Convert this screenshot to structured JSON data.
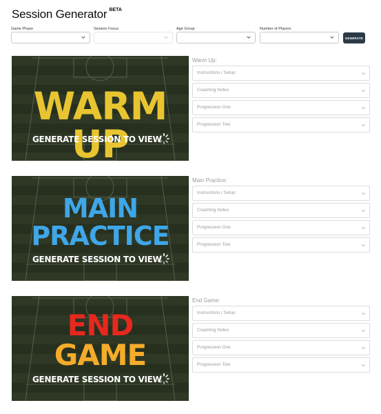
{
  "header": {
    "title": "Session Generator",
    "badge": "BETA"
  },
  "filters": [
    {
      "label": "Game Phase",
      "value": ""
    },
    {
      "label": "Session Focus",
      "value": ""
    },
    {
      "label": "Age Group",
      "value": ""
    },
    {
      "label": "Number of Players",
      "value": ""
    }
  ],
  "generate_button": "GENERATE",
  "sections": [
    {
      "title": "Warm Up:",
      "banner_lines": [
        "WARM UP"
      ],
      "banner_color": "#e8c530",
      "banner_caption": "GENERATE SESSION TO VIEW",
      "items": [
        "Instructions / Setup",
        "Coaching Notes",
        "Progression One",
        "Progression Two"
      ]
    },
    {
      "title": "Main Practice:",
      "banner_lines": [
        "MAIN",
        "PRACTICE"
      ],
      "banner_color": "#3fa6e8",
      "banner_caption": "GENERATE SESSION TO VIEW",
      "items": [
        "Instructions / Setup",
        "Coaching Notes",
        "Progression One",
        "Progression Two"
      ]
    },
    {
      "title": "End Game:",
      "banner_lines": [
        "END",
        "GAME"
      ],
      "banner_colors": [
        "#e8271d",
        "#f4ac2a"
      ],
      "banner_caption": "GENERATE SESSION TO VIEW",
      "items": [
        "Instructions / Setup",
        "Coaching Notes",
        "Progression One",
        "Progression Two"
      ]
    }
  ]
}
